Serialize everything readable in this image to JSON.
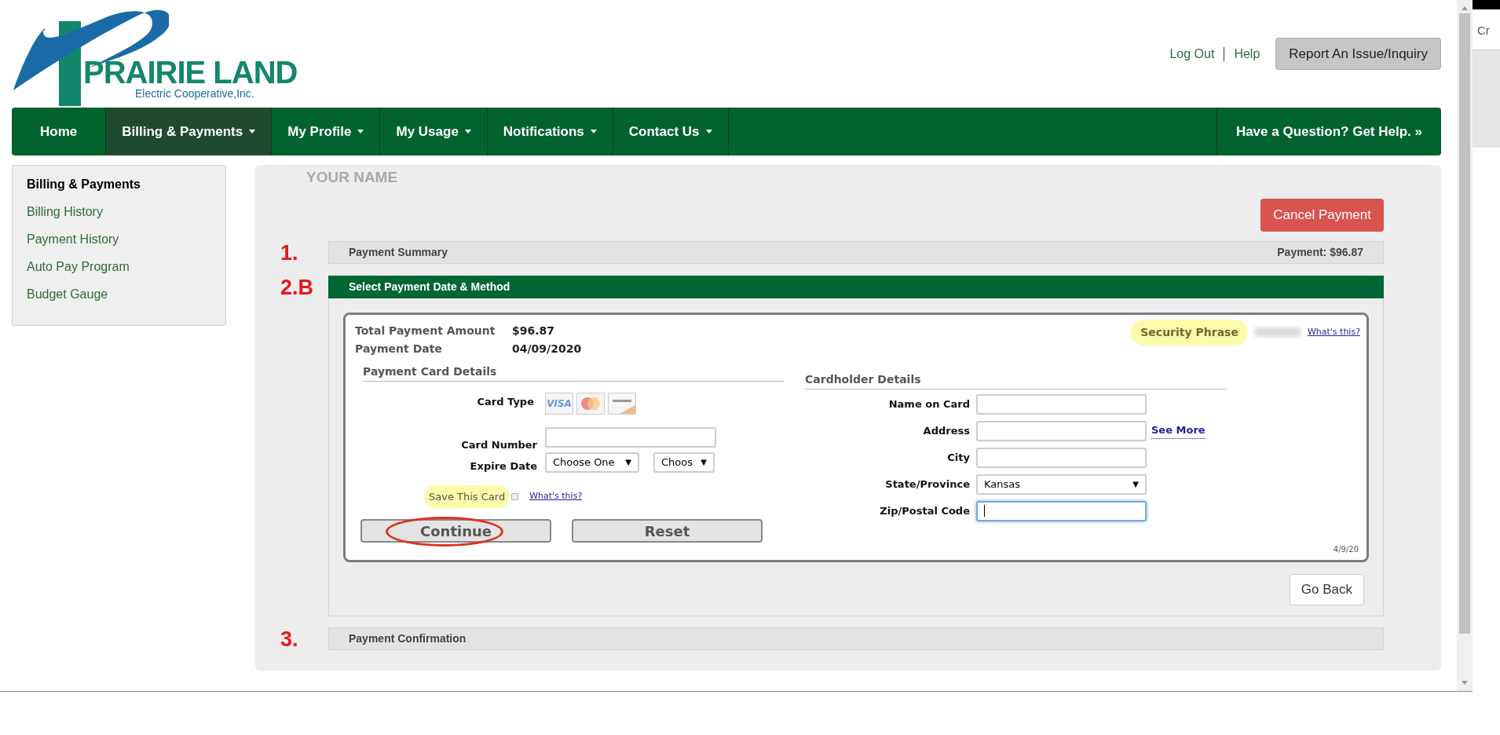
{
  "logo": {
    "name": "PRAIRIE LAND",
    "subtitle": "Electric Cooperative,Inc."
  },
  "top_links": [
    "Log Out",
    "Help"
  ],
  "report_button": "Report An Issue/Inquiry",
  "nav": {
    "items": [
      {
        "label": "Home",
        "dropdown": false,
        "selected": false
      },
      {
        "label": "Billing & Payments",
        "dropdown": true,
        "selected": true
      },
      {
        "label": "My Profile",
        "dropdown": true,
        "selected": false
      },
      {
        "label": "My Usage",
        "dropdown": true,
        "selected": false
      },
      {
        "label": "Notifications",
        "dropdown": true,
        "selected": false
      },
      {
        "label": "Contact Us",
        "dropdown": true,
        "selected": false
      }
    ],
    "help_link": "Have a Question? Get Help. »"
  },
  "sidebar": {
    "items": [
      {
        "label": "Billing & Payments",
        "kind": "heading"
      },
      {
        "label": "Billing History",
        "kind": "link"
      },
      {
        "label": "Payment History",
        "kind": "link"
      },
      {
        "label": "Auto Pay Program",
        "kind": "link"
      },
      {
        "label": "Budget Gauge",
        "kind": "link"
      }
    ]
  },
  "account_name": "YOUR NAME",
  "cancel_button": "Cancel Payment",
  "steps": [
    {
      "number": "1.",
      "title": "Payment Summary",
      "summary": "Payment: $96.87",
      "expanded": false
    },
    {
      "number": "2.B",
      "title": "Select Payment Date & Method",
      "expanded": true
    },
    {
      "number": "3.",
      "title": "Payment Confirmation",
      "expanded": false
    }
  ],
  "payment": {
    "total_label": "Total Payment Amount",
    "total": "$96.87",
    "date_label": "Payment Date",
    "date": "04/09/2020",
    "security_label": "Security Phrase",
    "security_link": "What's this?",
    "card_heading": "Payment Card Details",
    "card_type_label": "Card Type",
    "visa": "VISA",
    "card_number_label": "Card Number",
    "expire_label": "Expire Date",
    "expire_month": "Choose One",
    "expire_year": "Choos",
    "save_label": "Save This Card",
    "save_checked": false,
    "save_link": "What's this?",
    "holder_heading": "Cardholder Details",
    "select_arrow": "▼",
    "holder_fields": [
      {
        "label": "Name on Card",
        "kind": "text",
        "focused": false
      },
      {
        "label": "Address",
        "kind": "text",
        "focused": false,
        "link": "See More"
      },
      {
        "label": "City",
        "kind": "text",
        "focused": false
      },
      {
        "label": "State/Province",
        "kind": "select",
        "value": "Kansas",
        "focused": false
      },
      {
        "label": "Zip/Postal Code",
        "kind": "text",
        "focused": true
      }
    ],
    "buttons": [
      "Continue",
      "Reset"
    ],
    "footnote": "4/9/20"
  },
  "go_back": "Go Back",
  "side_panel_text": "Cr"
}
